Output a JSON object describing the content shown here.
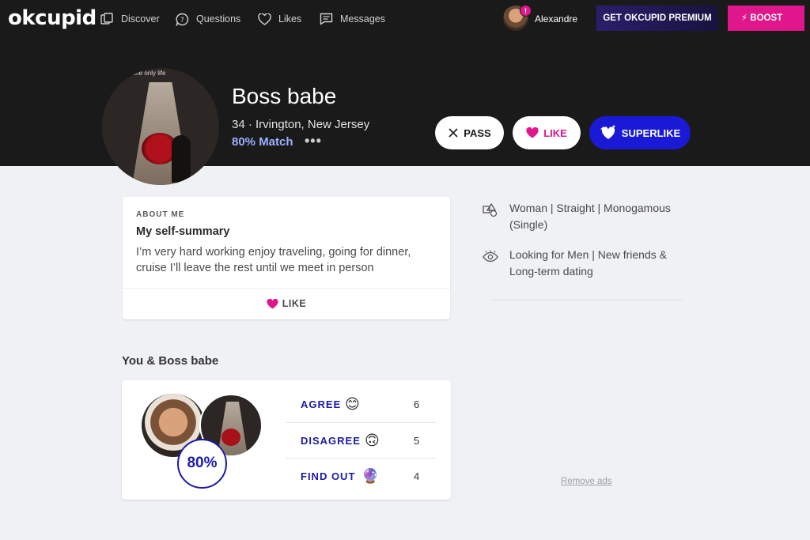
{
  "nav": {
    "logo": "okcupid",
    "items": [
      {
        "label": "Discover",
        "icon": "discover-icon"
      },
      {
        "label": "Questions",
        "icon": "questions-icon"
      },
      {
        "label": "Likes",
        "icon": "heart-icon"
      },
      {
        "label": "Messages",
        "icon": "messages-icon"
      }
    ],
    "user_name": "Alexandre",
    "notification_badge": "!",
    "premium_label": "GET OKCUPID PREMIUM",
    "boost_label": "BOOST"
  },
  "profile": {
    "photo_caption": "the only life",
    "name": "Boss babe",
    "age_location": "34 · Irvington, New Jersey",
    "match": "80% Match",
    "more": "•••",
    "pass_label": "PASS",
    "like_label": "LIKE",
    "superlike_label": "SUPERLIKE"
  },
  "about": {
    "header": "ABOUT ME",
    "title": "My self-summary",
    "text": "I’m very hard working enjoy traveling, going for dinner, cruise I’ll leave the rest until we meet in person",
    "like_label": "LIKE"
  },
  "details": {
    "identity": "Woman | Straight | Monogamous (Single)",
    "looking_for": "Looking for Men | New friends & Long-term dating"
  },
  "compare": {
    "title": "You & Boss babe",
    "match_percent": "80%",
    "rows": [
      {
        "label": "AGREE",
        "emoji": "😊",
        "count": "6"
      },
      {
        "label": "DISAGREE",
        "emoji": "🙃",
        "count": "5"
      },
      {
        "label": "FIND OUT",
        "emoji": "🔮",
        "count": "4"
      }
    ]
  },
  "ads": {
    "remove_label": "Remove ads"
  },
  "colors": {
    "accent_pink": "#e0168c",
    "accent_blue": "#1b1ba8",
    "superlike_blue": "#1a1ad6",
    "dark": "#1a1a1a"
  }
}
